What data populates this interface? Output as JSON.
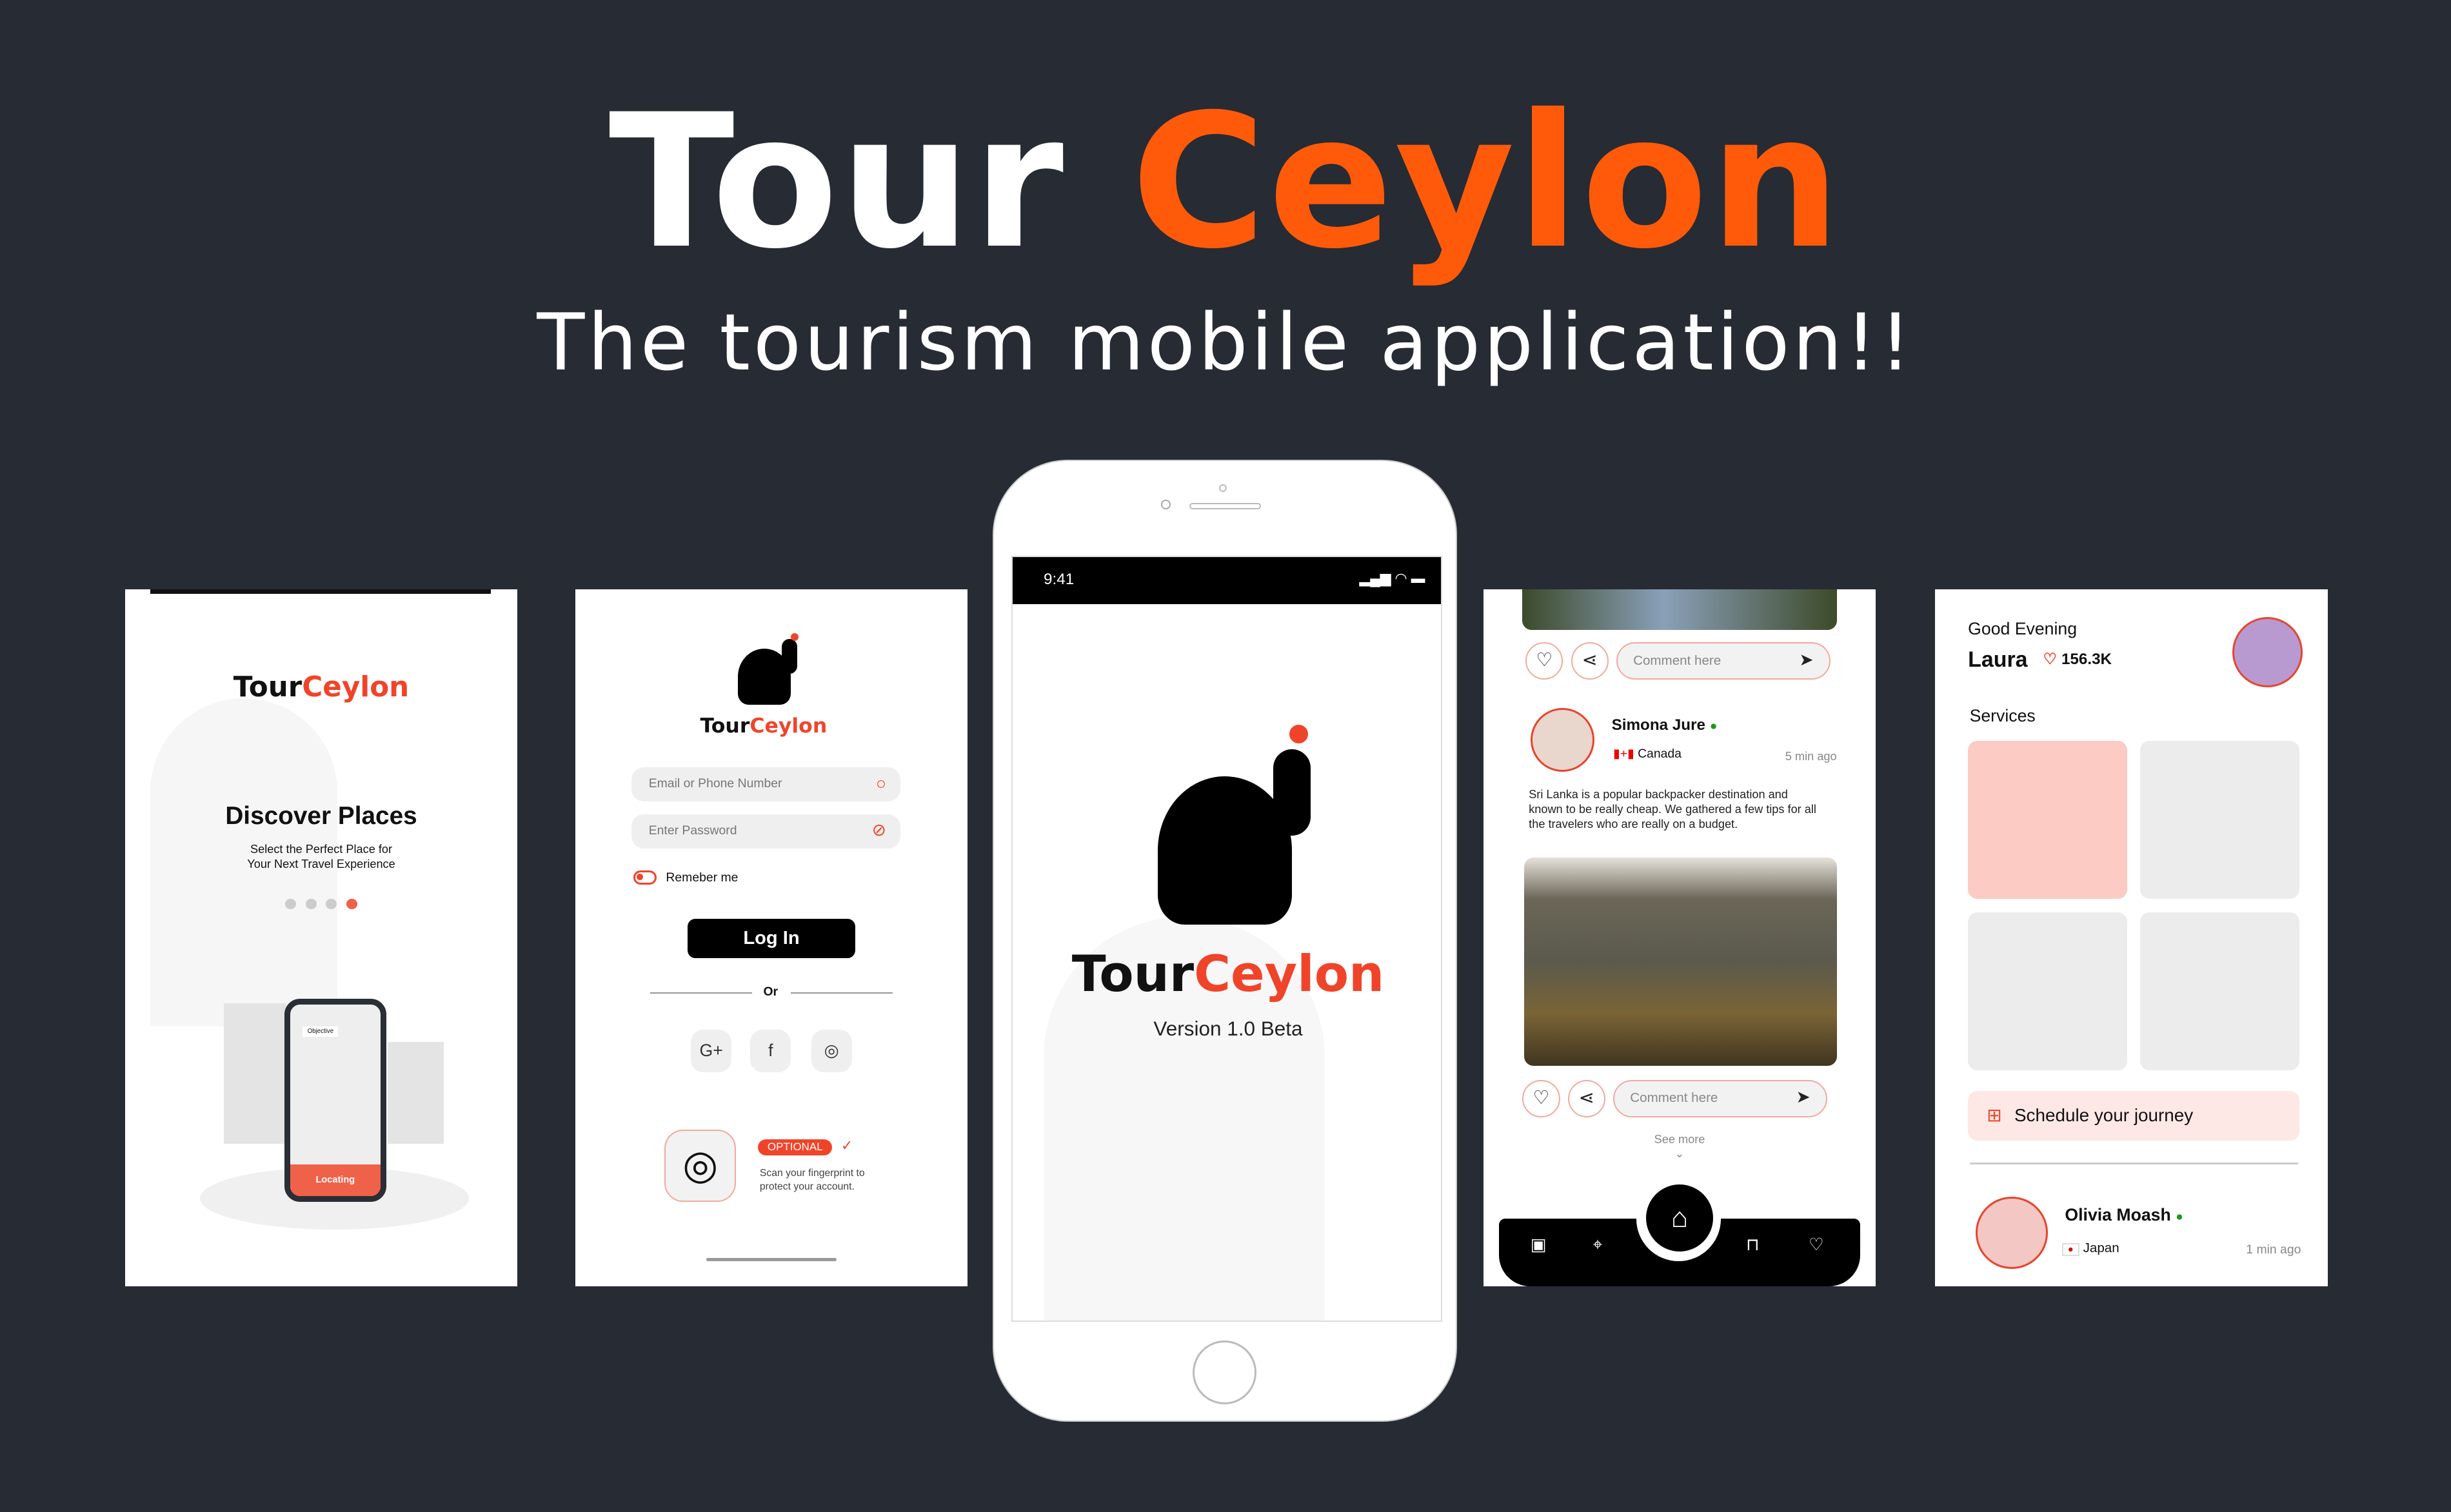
{
  "hero": {
    "title_white": "Tour",
    "title_orange": "Ceylon",
    "subtitle": "The tourism mobile application!!"
  },
  "colors": {
    "background": "#272b33",
    "accent": "#ff5a0a",
    "brand_red": "#f0442a"
  },
  "onboarding": {
    "logo_a": "Tour",
    "logo_b": "Ceylon",
    "heading": "Discover Places",
    "desc_1": "Select the Perfect Place for",
    "desc_2": "Your Next Travel Experience",
    "page_dots": 4,
    "active_dot": 4,
    "illustration_label": "Objective",
    "illustration_button": "Locating"
  },
  "login": {
    "logo_a": "Tour",
    "logo_b": "Ceylon",
    "email_placeholder": "Email or Phone Number",
    "password_placeholder": "Enter Password",
    "remember": "Remeber me",
    "login_button": "Log In",
    "divider": "Or",
    "social": [
      "google-plus-icon",
      "facebook-icon",
      "instagram-icon"
    ],
    "social_glyphs": [
      "G+",
      "f",
      "◎"
    ],
    "optional_badge": "OPTIONAL",
    "fingerprint_1": "Scan your fingerprint to",
    "fingerprint_2": "protect your account."
  },
  "splash": {
    "time": "9:41",
    "logo_a": "Tour",
    "logo_b": "Ceylon",
    "version": "Version 1.0 Beta"
  },
  "feed": {
    "comment_placeholder": "Comment here",
    "user": "Simona Jure",
    "country": "Canada",
    "time": "5 min ago",
    "post": "Sri Lanka is a popular backpacker destination and known to be really cheap. We gathered a few tips for all the travelers who are really on a budget.",
    "see_more": "See more"
  },
  "home": {
    "greeting": "Good Evening",
    "name": "Laura",
    "likes": "156.3K",
    "services_title": "Services",
    "services": [
      "navigation",
      "car-rental",
      "hotel-booking",
      "warning"
    ],
    "schedule": "Schedule your journey",
    "user": "Olivia Moash",
    "country": "Japan",
    "time": "1 min ago"
  }
}
